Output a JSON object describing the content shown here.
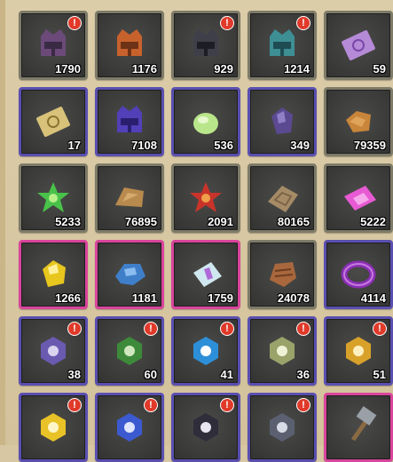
{
  "alert_mark": "!",
  "colors": {
    "rarity_gray": "#7d7b68",
    "rarity_purple": "#5a4fb0",
    "rarity_pink": "#d9459c",
    "rarity_blue": "#4a66b8",
    "alert_badge": "#e03a2a"
  },
  "inventory": {
    "rows": [
      [
        {
          "icon": "purple-helmet-icon",
          "count": "1790",
          "alert": true,
          "rarity": "gray"
        },
        {
          "icon": "orange-helmet-icon",
          "count": "1176",
          "alert": false,
          "rarity": "gray"
        },
        {
          "icon": "dark-helmet-icon",
          "count": "929",
          "alert": true,
          "rarity": "gray"
        },
        {
          "icon": "teal-helmet-icon",
          "count": "1214",
          "alert": true,
          "rarity": "gray"
        },
        {
          "icon": "purple-scroll-card-icon",
          "count": "59",
          "alert": false,
          "rarity": "gray"
        }
      ],
      [
        {
          "icon": "gold-scroll-card-icon",
          "count": "17",
          "alert": false,
          "rarity": "purple"
        },
        {
          "icon": "blue-helmet-icon",
          "count": "7108",
          "alert": false,
          "rarity": "purple"
        },
        {
          "icon": "green-orb-icon",
          "count": "536",
          "alert": false,
          "rarity": "purple"
        },
        {
          "icon": "purple-ore-icon",
          "count": "349",
          "alert": false,
          "rarity": "purple"
        },
        {
          "icon": "brown-leather-icon",
          "count": "79359",
          "alert": false,
          "rarity": "gray"
        }
      ],
      [
        {
          "icon": "green-leaf-icon",
          "count": "5233",
          "alert": false,
          "rarity": "gray"
        },
        {
          "icon": "brown-hide-icon",
          "count": "76895",
          "alert": false,
          "rarity": "gray"
        },
        {
          "icon": "red-leaf-icon",
          "count": "2091",
          "alert": false,
          "rarity": "gray"
        },
        {
          "icon": "cloth-patch-icon",
          "count": "80165",
          "alert": false,
          "rarity": "gray"
        },
        {
          "icon": "pink-scroll-icon",
          "count": "5222",
          "alert": false,
          "rarity": "gray"
        }
      ],
      [
        {
          "icon": "gold-ore-icon",
          "count": "1266",
          "alert": false,
          "rarity": "pink"
        },
        {
          "icon": "blue-ore-icon",
          "count": "1181",
          "alert": false,
          "rarity": "pink"
        },
        {
          "icon": "blue-scroll-icon",
          "count": "1759",
          "alert": false,
          "rarity": "pink"
        },
        {
          "icon": "leather-bundle-icon",
          "count": "24078",
          "alert": false,
          "rarity": "gray"
        },
        {
          "icon": "purple-ring-icon",
          "count": "4114",
          "alert": false,
          "rarity": "purple"
        }
      ],
      [
        {
          "icon": "purple-emblem-icon",
          "count": "38",
          "alert": true,
          "rarity": "purple"
        },
        {
          "icon": "green-emblem-icon",
          "count": "60",
          "alert": true,
          "rarity": "purple"
        },
        {
          "icon": "blue-snowflake-emblem-icon",
          "count": "41",
          "alert": true,
          "rarity": "purple"
        },
        {
          "icon": "olive-emblem-icon",
          "count": "36",
          "alert": true,
          "rarity": "purple"
        },
        {
          "icon": "gold-emblem-icon",
          "count": "51",
          "alert": true,
          "rarity": "purple"
        }
      ],
      [
        {
          "icon": "yellow-emblem-icon",
          "count": "",
          "alert": true,
          "rarity": "purple"
        },
        {
          "icon": "blue-shield-emblem-icon",
          "count": "",
          "alert": true,
          "rarity": "purple"
        },
        {
          "icon": "skull-emblem-icon",
          "count": "",
          "alert": true,
          "rarity": "purple"
        },
        {
          "icon": "stone-emblem-icon",
          "count": "",
          "alert": true,
          "rarity": "purple"
        },
        {
          "icon": "hammer-icon",
          "count": "",
          "alert": false,
          "rarity": "pink"
        }
      ]
    ]
  }
}
